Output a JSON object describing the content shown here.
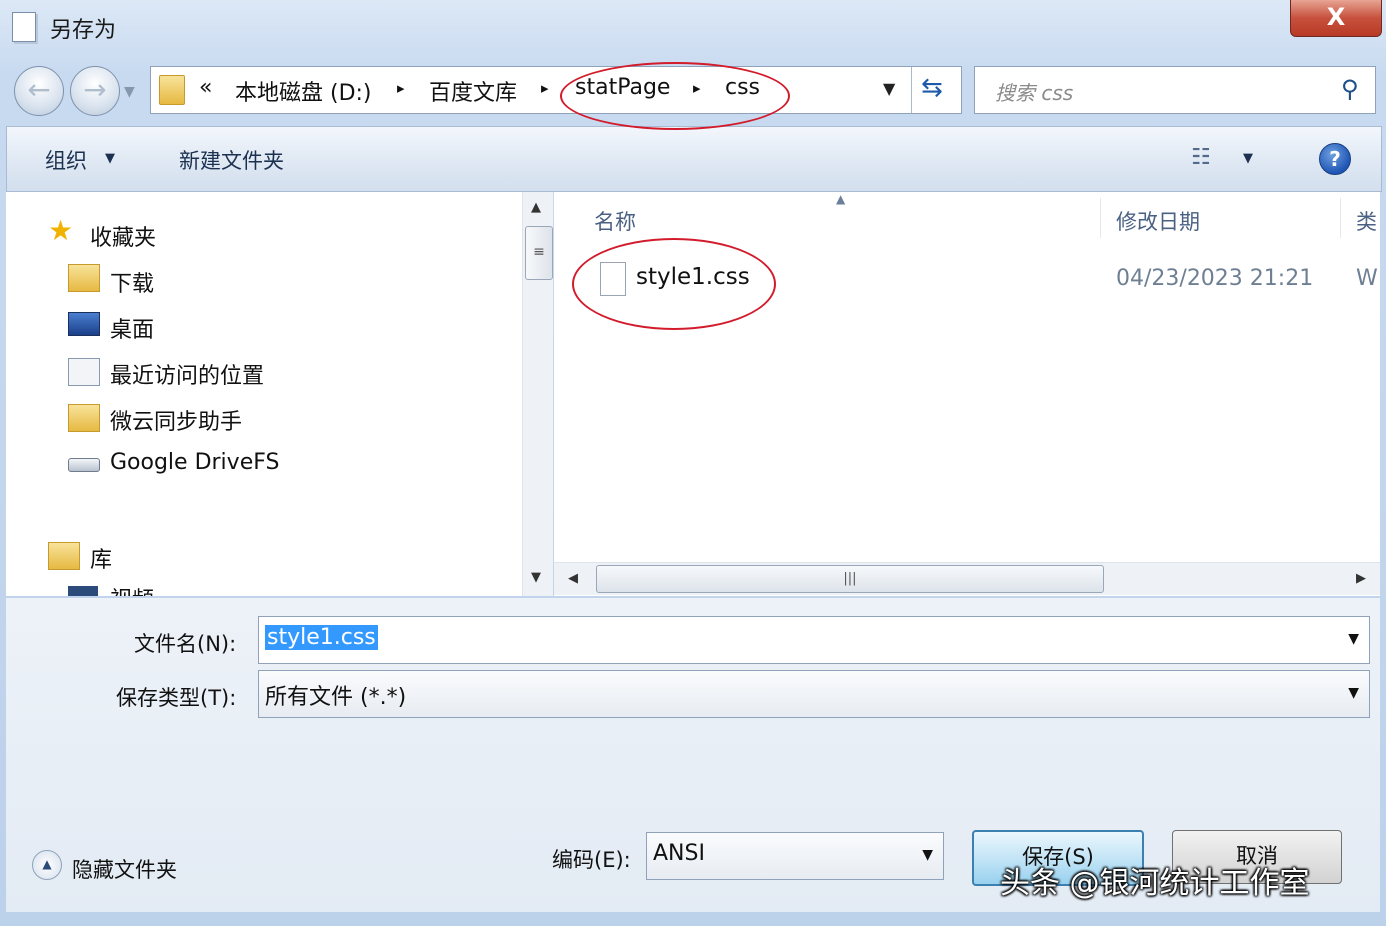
{
  "window": {
    "title": "另存为",
    "close_label": "X"
  },
  "address": {
    "prefix": "«",
    "crumbs": [
      "本地磁盘 (D:)",
      "百度文库",
      "statPage",
      "css"
    ],
    "separator": "▸"
  },
  "search": {
    "placeholder": "搜索 css"
  },
  "toolbar": {
    "organize_label": "组织",
    "new_folder_label": "新建文件夹",
    "help_label": "?"
  },
  "sidebar": {
    "items": [
      {
        "label": "收藏夹",
        "icon": "star-icon"
      },
      {
        "label": "下载",
        "icon": "download-folder-icon"
      },
      {
        "label": "桌面",
        "icon": "desktop-icon"
      },
      {
        "label": "最近访问的位置",
        "icon": "recent-places-icon"
      },
      {
        "label": "微云同步助手",
        "icon": "cloud-folder-icon"
      },
      {
        "label": "Google DriveFS",
        "icon": "drive-icon"
      },
      {
        "label": "库",
        "icon": "library-icon"
      },
      {
        "label": "视频",
        "icon": "video-library-icon"
      }
    ]
  },
  "file_list": {
    "columns": [
      "名称",
      "修改日期",
      "类"
    ],
    "rows": [
      {
        "name": "style1.css",
        "modified": "04/23/2023 21:21",
        "type": "W"
      }
    ]
  },
  "form": {
    "filename_label": "文件名(N):",
    "filename_value": "style1.css",
    "filetype_label": "保存类型(T):",
    "filetype_value": "所有文件  (*.*)",
    "encoding_label": "编码(E):",
    "encoding_value": "ANSI"
  },
  "buttons": {
    "save_label": "保存(S)",
    "cancel_label": "取消",
    "hide_folders_label": "隐藏文件夹"
  },
  "watermark": "头条 @银河统计工作室",
  "colors": {
    "annotation": "#d21c2c",
    "selection": "#3399ff",
    "close_button": "#c7513e"
  }
}
